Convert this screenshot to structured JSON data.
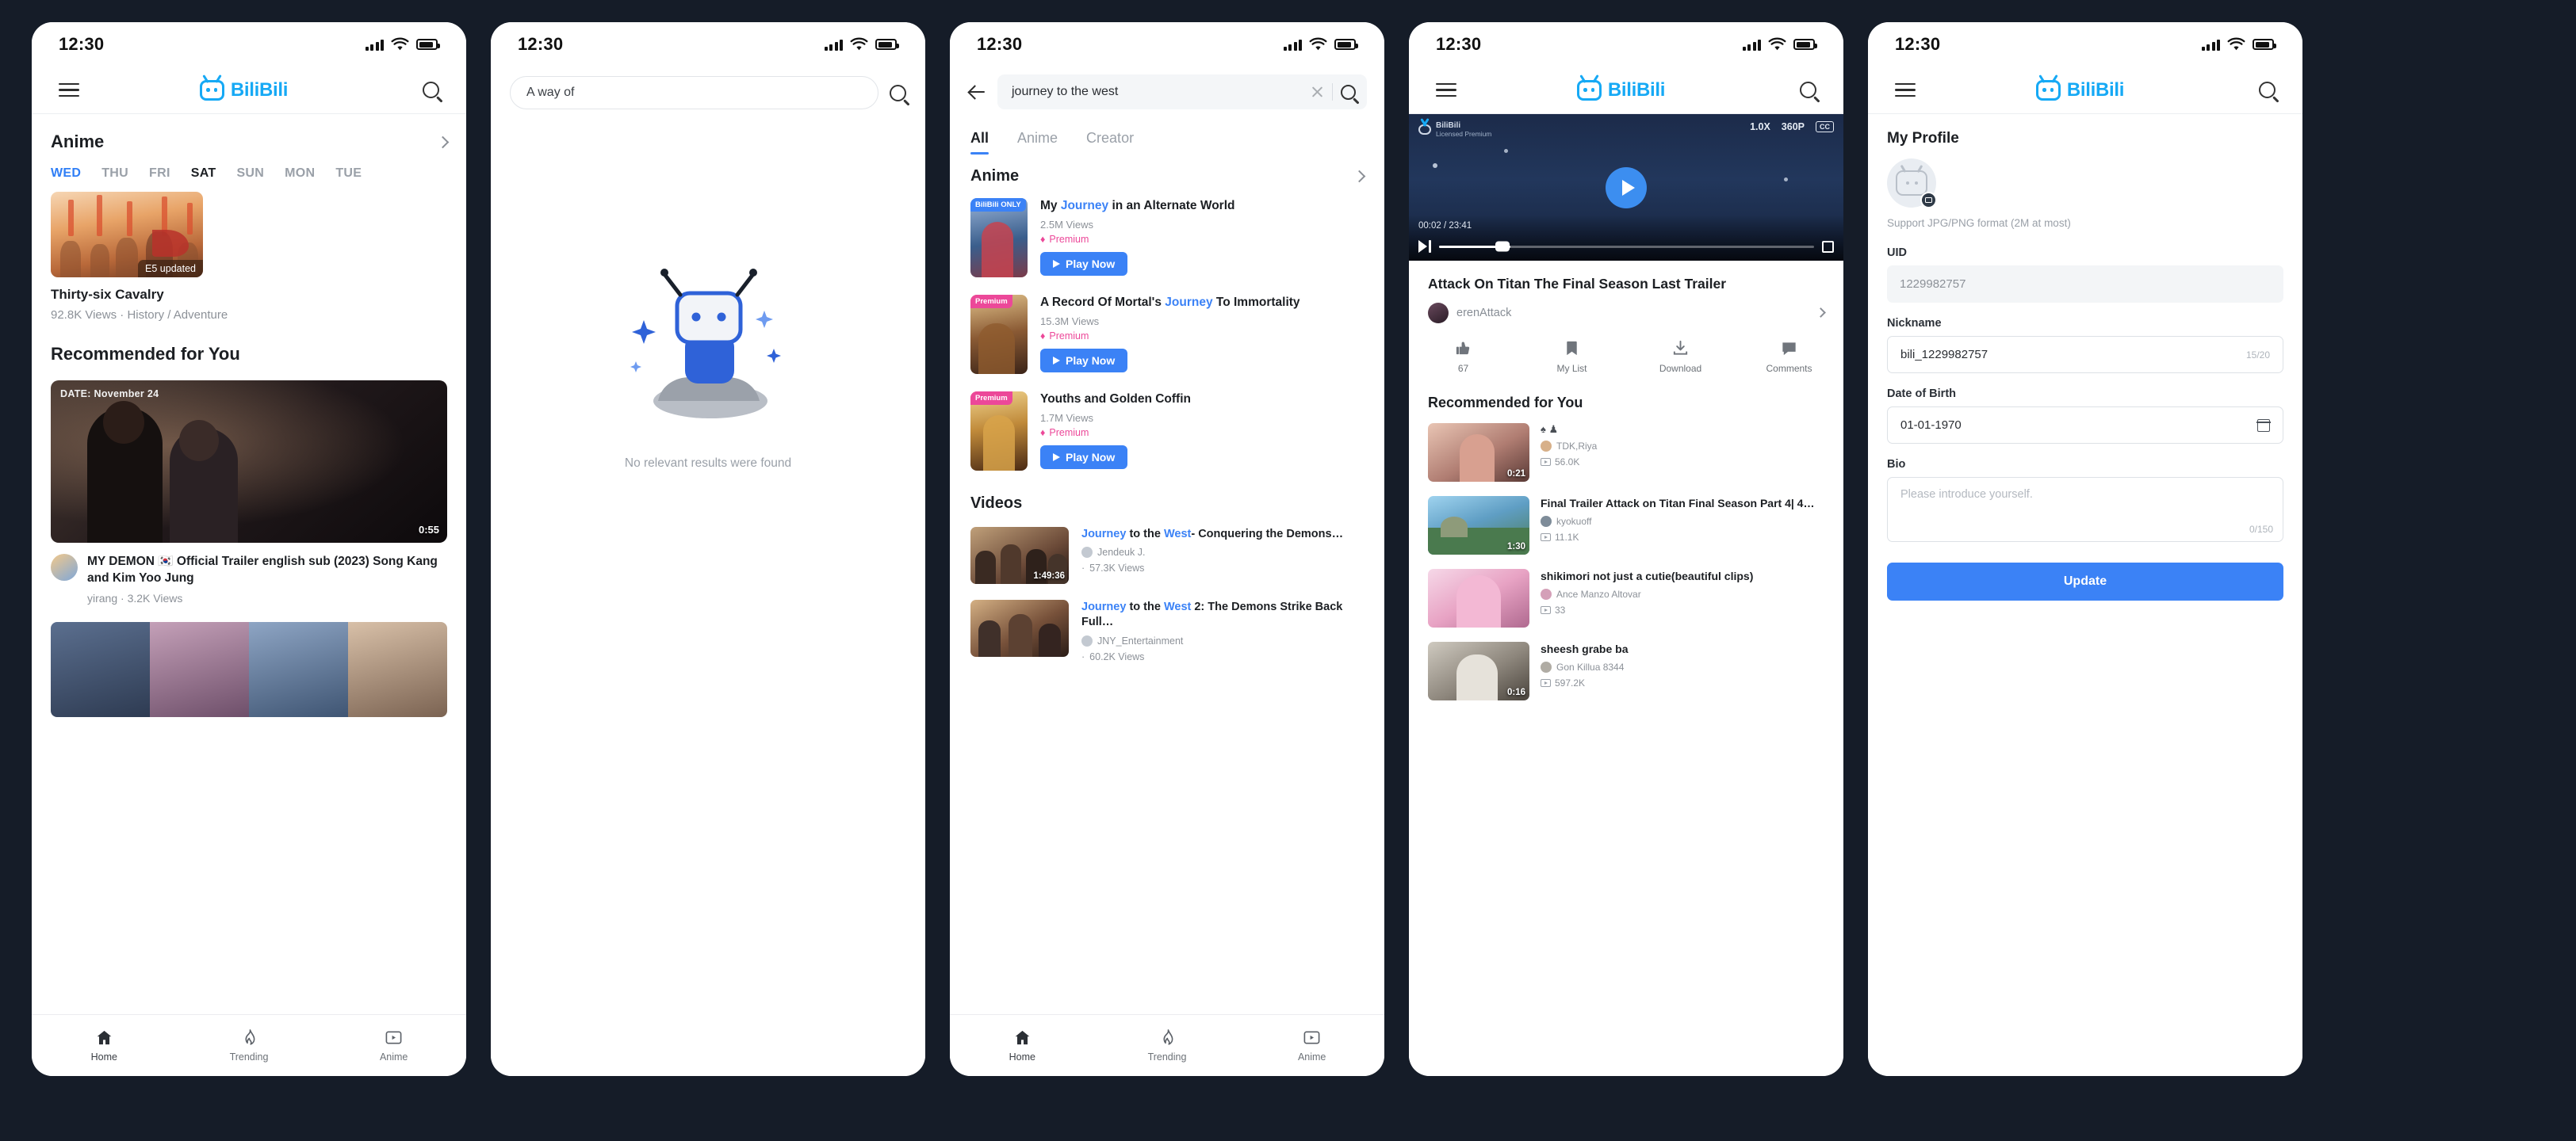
{
  "status_bar": {
    "time": "12:30"
  },
  "brand": {
    "name": "BiliBili"
  },
  "phone1": {
    "section": {
      "title": "Anime",
      "chevron": "chevron-right-icon"
    },
    "days": [
      {
        "label": "WED",
        "state": "active"
      },
      {
        "label": "THU",
        "state": "normal"
      },
      {
        "label": "FRI",
        "state": "normal"
      },
      {
        "label": "SAT",
        "state": "current"
      },
      {
        "label": "SUN",
        "state": "normal"
      },
      {
        "label": "MON",
        "state": "normal"
      },
      {
        "label": "TUE",
        "state": "normal"
      }
    ],
    "anime_card": {
      "badge": "E5 updated",
      "title": "Thirty-six Cavalry",
      "meta": "92.8K Views · History / Adventure"
    },
    "recommended_title": "Recommended for You",
    "video": {
      "date_tag": "DATE: November 24",
      "duration": "0:55",
      "title": "MY DEMON 🇰🇷 Official Trailer english sub (2023) Song Kang and Kim Yoo Jung",
      "meta": "yirang · 3.2K Views"
    },
    "tabs": [
      {
        "label": "Home",
        "icon": "home-icon",
        "active": true
      },
      {
        "label": "Trending",
        "icon": "trending-icon",
        "active": false
      },
      {
        "label": "Anime",
        "icon": "anime-icon",
        "active": false
      }
    ]
  },
  "phone2": {
    "search_value": "A way of",
    "search_icon": "search-icon",
    "empty_text": "No relevant results were found"
  },
  "phone3": {
    "back_icon": "back-arrow-icon",
    "search_value": "journey to the west",
    "clear_icon": "clear-icon",
    "search_icon": "search-icon",
    "tabs": [
      {
        "label": "All",
        "active": true
      },
      {
        "label": "Anime",
        "active": false
      },
      {
        "label": "Creator",
        "active": false
      }
    ],
    "anime_section": {
      "title": "Anime",
      "chevron": "chevron-right-icon"
    },
    "anime_results": [
      {
        "flag": "BiliBili ONLY",
        "flag_type": "only",
        "title_pre": "My ",
        "title_hl": "Journey",
        "title_post": " in an Alternate World",
        "views": "2.5M Views",
        "premium": "Premium",
        "play": "Play Now"
      },
      {
        "flag": "Premium",
        "flag_type": "prem",
        "title_pre": "A Record Of Mortal's ",
        "title_hl": "Journey",
        "title_post": " To Immortality",
        "views": "15.3M Views",
        "premium": "Premium",
        "play": "Play Now"
      },
      {
        "flag": "Premium",
        "flag_type": "prem",
        "title_pre": "Youths and Golden Coffin",
        "title_hl": "",
        "title_post": "",
        "views": "1.7M Views",
        "premium": "Premium",
        "play": "Play Now"
      }
    ],
    "videos_title": "Videos",
    "videos": [
      {
        "title_pre": "",
        "title_hl1": "Journey",
        "title_mid": " to the ",
        "title_hl2": "West",
        "title_post": "- Conquering the Demons…",
        "duration": "1:49:36",
        "author": "Jendeuk J.",
        "views": "57.3K Views"
      },
      {
        "title_pre": "",
        "title_hl1": "Journey",
        "title_mid": " to the ",
        "title_hl2": "West",
        "title_post": " 2: The Demons Strike Back Full…",
        "duration": "",
        "author": "JNY_Entertainment",
        "views": "60.2K Views"
      }
    ],
    "tabs_bottom": [
      {
        "label": "Home",
        "icon": "home-icon",
        "active": true
      },
      {
        "label": "Trending",
        "icon": "trending-icon",
        "active": false
      },
      {
        "label": "Anime",
        "icon": "anime-icon",
        "active": false
      }
    ]
  },
  "phone4": {
    "player": {
      "logo": "BiliBili",
      "license": "Licensed Premium",
      "speed": "1.0X",
      "quality": "360P",
      "cc": "CC",
      "time": "00:02 / 23:41"
    },
    "video_title": "Attack On Titan The Final Season Last Trailer",
    "author": "erenAttack",
    "actions": [
      {
        "label": "67",
        "icon": "thumbs-up-icon"
      },
      {
        "label": "My List",
        "icon": "bookmark-icon"
      },
      {
        "label": "Download",
        "icon": "download-icon"
      },
      {
        "label": "Comments",
        "icon": "comments-icon"
      }
    ],
    "recommended_title": "Recommended for You",
    "recommendations": [
      {
        "title": "",
        "author": "TDK,Riya",
        "duration": "0:21",
        "views": "56.0K",
        "badges": "♠ ♟"
      },
      {
        "title": "Final Trailer Attack on Titan Final Season Part 4| 4…",
        "author": "kyokuoff",
        "duration": "1:30",
        "views": "11.1K"
      },
      {
        "title": "shikimori not just a cutie(beautiful clips)",
        "author": "Ance Manzo Altovar",
        "duration": "",
        "views": "33"
      },
      {
        "title": "sheesh grabe ba",
        "author": "Gon Killua  8344",
        "duration": "0:16",
        "views": "597.2K"
      }
    ]
  },
  "phone5": {
    "title": "My Profile",
    "avatar_icon": "avatar-placeholder-icon",
    "camera_icon": "camera-icon",
    "support_text": "Support JPG/PNG format (2M at most)",
    "fields": [
      {
        "label": "UID",
        "value": "1229982757",
        "type": "readonly"
      },
      {
        "label": "Nickname",
        "value": "bili_1229982757",
        "counter": "15/20",
        "type": "text"
      },
      {
        "label": "Date of Birth",
        "value": "01-01-1970",
        "type": "date"
      }
    ],
    "bio": {
      "label": "Bio",
      "placeholder": "Please introduce yourself.",
      "counter": "0/150"
    },
    "update_button": "Update"
  },
  "colors": {
    "brand": "#16a9f5",
    "accent": "#3b82f6",
    "premium": "#ec4899",
    "bg": "#151c28"
  }
}
